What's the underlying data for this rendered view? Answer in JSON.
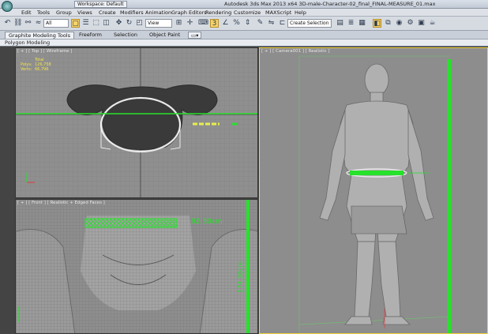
{
  "titlebar": {
    "workspace": "Workspace: Default",
    "title": "Autodesk 3ds Max  2013 x64     3D-male-Character-02_final_FINAL-MEASURE_01.max"
  },
  "menu": [
    "Edit",
    "Tools",
    "Group",
    "Views",
    "Create",
    "Modifiers",
    "Animation",
    "Graph Editors",
    "Rendering",
    "Customize",
    "MAXScript",
    "Help"
  ],
  "toolbar": {
    "selection_filter": "All",
    "reference_coord": "View",
    "named_selection": "Create Selection Se"
  },
  "ribbon": {
    "tabs": [
      "Graphite Modeling Tools",
      "Freeform",
      "Selection",
      "Object Paint"
    ],
    "active_tab": 0,
    "panel_label": "Polygon Modeling"
  },
  "viewports": {
    "top": {
      "label": "[ + ] [ Top ] [ Wireframe ]",
      "stats": {
        "total": "Total",
        "polys_label": "Polys:",
        "polys_value": "126,758",
        "verts_label": "Verts:",
        "verts_value": "66,796"
      }
    },
    "front": {
      "label": "[ + ] [ Front ] [ Realistic + Edged Faces ]",
      "width_measure": "92.30cm",
      "height_measure": "174.30cm"
    },
    "camera": {
      "label": "[ + ] [ Camera001 ] [ Realistic ]"
    }
  },
  "colors": {
    "measure_green": "#27e12b",
    "active_border": "#f2d23b",
    "viewport_bg": "#9b9b9b"
  }
}
